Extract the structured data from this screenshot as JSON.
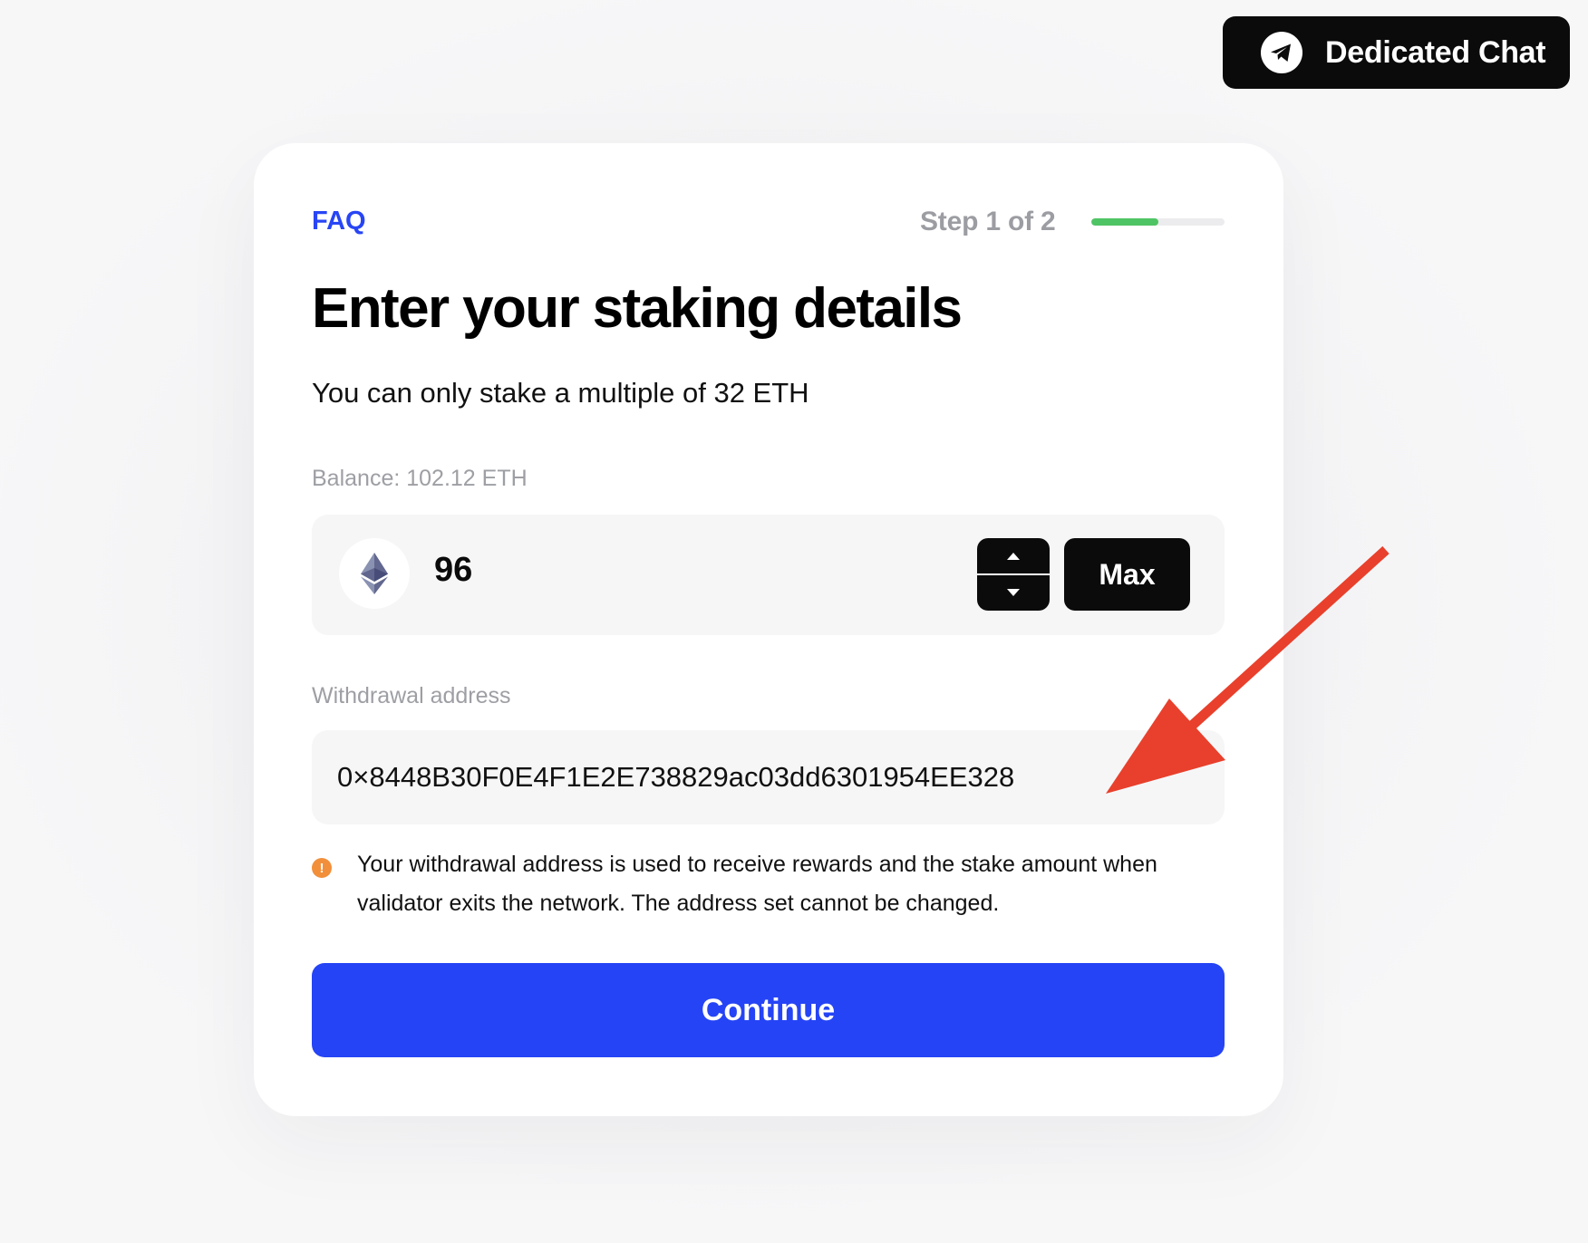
{
  "chat_button": {
    "label": "Dedicated Chat",
    "icon": "telegram-icon"
  },
  "card": {
    "faq_label": "FAQ",
    "step_label": "Step 1 of 2",
    "progress_fraction": 0.5,
    "progress_color": "#4fc464",
    "title": "Enter your staking details",
    "subtitle": "You can only stake a multiple of 32 ETH"
  },
  "amount": {
    "balance_label": "Balance: 102.12 ETH",
    "value": "96",
    "token_icon": "ethereum-icon",
    "max_label": "Max"
  },
  "withdrawal": {
    "label": "Withdrawal address",
    "value": "0×8448B30F0E4F1E2E738829ac03dd6301954EE328",
    "notice": "Your withdrawal address is used to receive rewards and the stake amount when validator exits the network. The address set cannot be changed.",
    "notice_icon": "warning-icon",
    "notice_icon_glyph": "!"
  },
  "continue_label": "Continue",
  "colors": {
    "accent": "#2544f5",
    "annotation_arrow": "#e8402c",
    "warning": "#f28f3b"
  }
}
